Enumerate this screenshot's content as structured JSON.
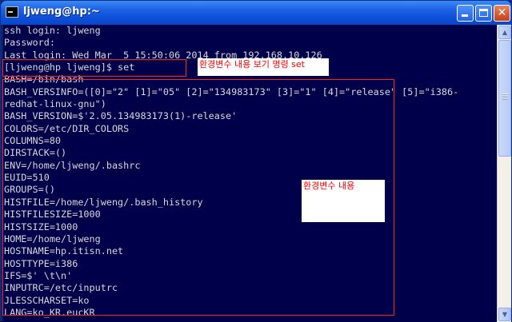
{
  "window": {
    "title": "ljweng@hp:~"
  },
  "titlebar": {
    "close_glyph": "✕"
  },
  "terminal": {
    "lines": [
      "ssh login: ljweng",
      "Password:",
      "Last login: Wed Mar  5 15:50:06 2014 from 192.168.10.126",
      "[ljweng@hp ljweng]$ set",
      "BASH=/bin/bash",
      "BASH_VERSINFO=([0]=\"2\" [1]=\"05\" [2]=\"134983173\" [3]=\"1\" [4]=\"release\" [5]=\"i386-",
      "redhat-linux-gnu\")",
      "BASH_VERSION=$'2.05.134983173(1)-release'",
      "COLORS=/etc/DIR_COLORS",
      "COLUMNS=80",
      "DIRSTACK=()",
      "ENV=/home/ljweng/.bashrc",
      "EUID=510",
      "GROUPS=()",
      "HISTFILE=/home/ljweng/.bash_history",
      "HISTFILESIZE=1000",
      "HISTSIZE=1000",
      "HOME=/home/ljweng",
      "HOSTNAME=hp.itisn.net",
      "HOSTTYPE=i386",
      "IFS=$' \\t\\n'",
      "INPUTRC=/etc/inputrc",
      "JLESSCHARSET=ko",
      "LANG=ko_KR.eucKR"
    ]
  },
  "annotations": {
    "command_note": "환경변수 내용 보기 명령 set",
    "content_note": "환경변수 내용"
  },
  "colors": {
    "console_background": "#00004a",
    "console_text": "#d8d8d8",
    "annotation_red": "#ff0000",
    "titlebar_blue": "#0d4fd8"
  }
}
